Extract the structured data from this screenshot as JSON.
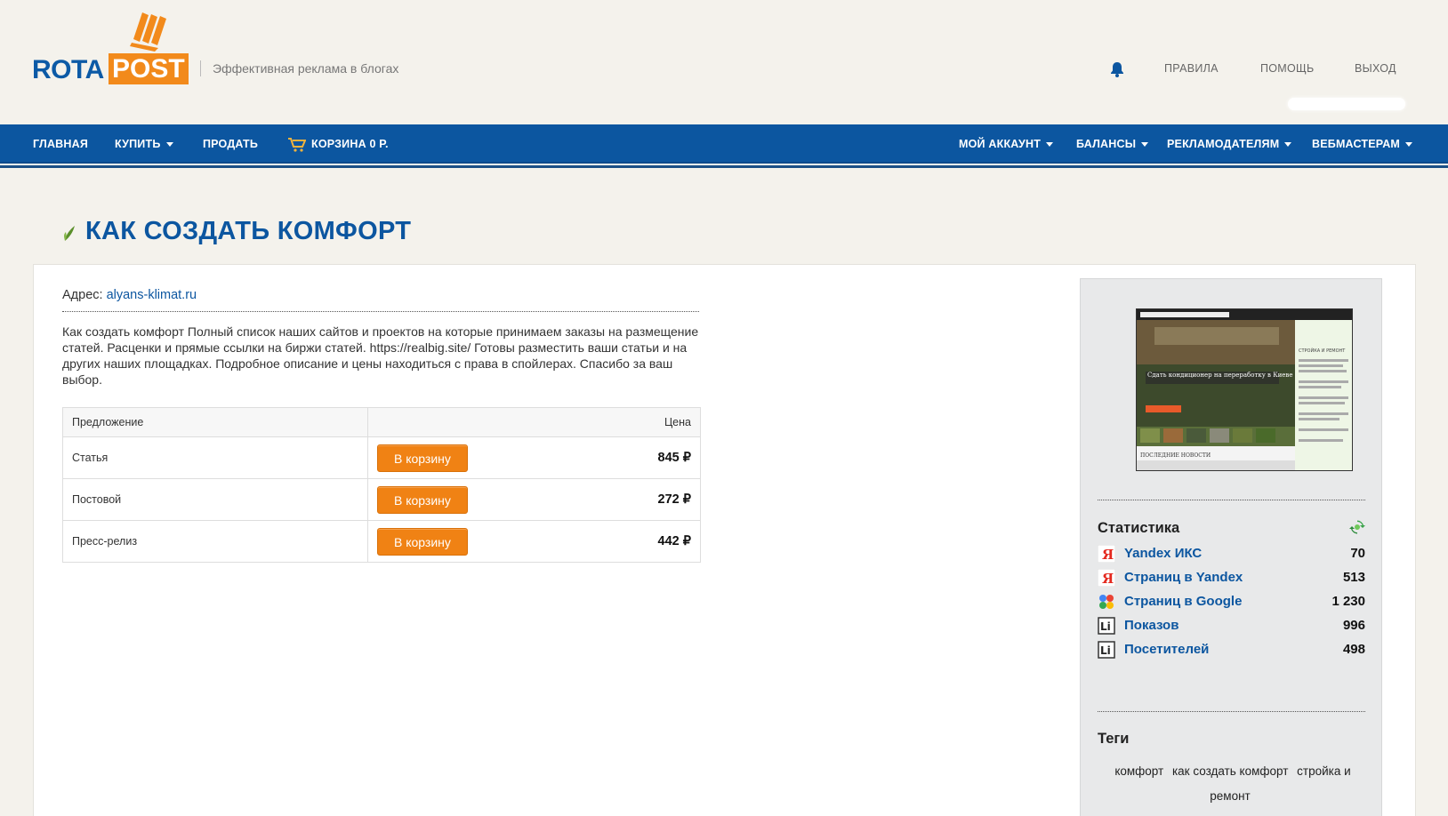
{
  "header": {
    "logo_left": "ROTA",
    "logo_right": "POST",
    "tagline": "Эффективная реклама в блогах",
    "links": [
      "ПРАВИЛА",
      "ПОМОЩЬ",
      "ВЫХОД"
    ]
  },
  "nav": {
    "home": "ГЛАВНАЯ",
    "buy": "КУПИТЬ",
    "sell": "ПРОДАТЬ",
    "cart": "КОРЗИНА 0 Р.",
    "account": "МОЙ АККАУНТ",
    "balances": "БАЛАНСЫ",
    "advertisers": "РЕКЛАМОДАТЕЛЯМ",
    "webmasters": "ВЕБМАСТЕРАМ"
  },
  "page": {
    "title": "КАК СОЗДАТЬ КОМФОРТ",
    "address_label": "Адрес: ",
    "address_link": "alyans-klimat.ru",
    "description": "Как создать комфорт Полный список наших сайтов и проектов на которые принимаем заказы на размещение статей. Расценки и прямые ссылки на биржи статей. https://realbig.site/ Готовы разместить ваши статьи и на других наших площадках. Подробное описание и цены находиться с права в спойлерах. Спасибо за ваш выбор."
  },
  "offers": {
    "col_offer": "Предложение",
    "col_price": "Цена",
    "button_label": "В корзину",
    "rows": [
      {
        "name": "Статья",
        "price": "845 ₽"
      },
      {
        "name": "Постовой",
        "price": "272 ₽"
      },
      {
        "name": "Пресс-релиз",
        "price": "442 ₽"
      }
    ]
  },
  "stats": {
    "title": "Статистика",
    "rows": [
      {
        "icon": "yandex-icon",
        "label": "Yandex ИКС",
        "value": "70"
      },
      {
        "icon": "yandex-icon",
        "label": "Страниц в Yandex",
        "value": "513"
      },
      {
        "icon": "google-icon",
        "label": "Страниц в Google",
        "value": "1 230"
      },
      {
        "icon": "liveinternet-icon",
        "label": "Показов",
        "value": "996"
      },
      {
        "icon": "liveinternet-icon",
        "label": "Посетителей",
        "value": "498"
      }
    ]
  },
  "tags": {
    "title": "Теги",
    "items": [
      "комфорт",
      "как создать комфорт",
      "стройка и ремонт"
    ]
  },
  "thumbnail": {
    "headline": "Сдать кондиционер на переработку в Киеве - Советы Хозяйке",
    "sidebar_title": "СТРОЙКА И РЕМОНТ",
    "footer": "ПОСЛЕДНИЕ НОВОСТИ"
  },
  "colors": {
    "brand_blue": "#0c56a0",
    "brand_orange": "#f28a1b",
    "button_orange": "#f08214"
  }
}
